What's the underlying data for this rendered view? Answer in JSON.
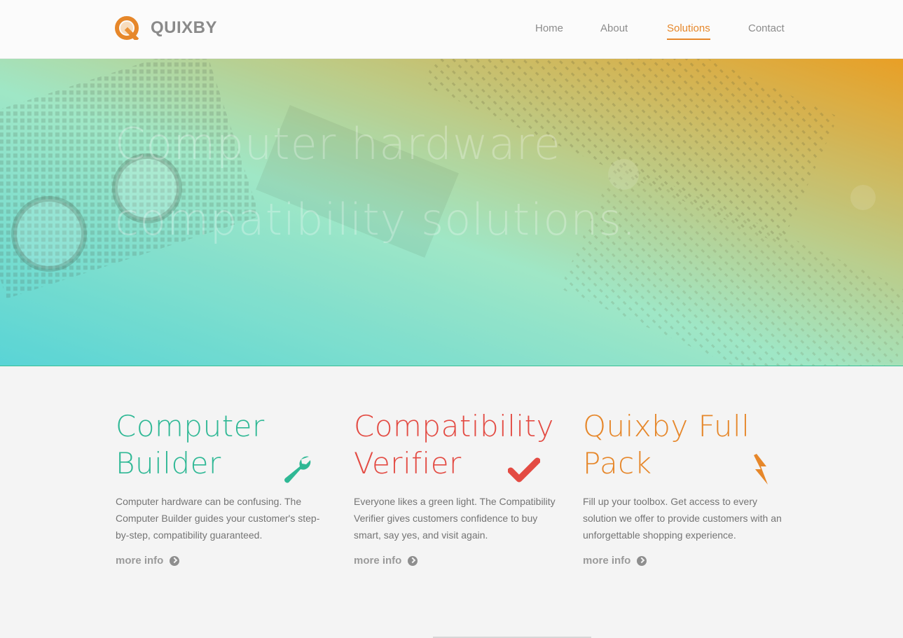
{
  "brand": {
    "name": "QUIXBY",
    "accent": "#e6872a"
  },
  "nav": {
    "items": [
      {
        "label": "Home"
      },
      {
        "label": "About"
      },
      {
        "label": "Solutions",
        "active": true
      },
      {
        "label": "Contact"
      }
    ]
  },
  "hero": {
    "title": "Computer hardware compatibility solutions.",
    "gradient": [
      "#4fd2d4",
      "#9ae6c3",
      "#e89a18"
    ]
  },
  "features": [
    {
      "title": "Computer Builder",
      "color": "#2fb895",
      "icon": "wrench-icon",
      "description": "Computer hardware can be confusing. The Computer Builder guides your customer's step-by-step, compatibility guaranteed.",
      "link": "more info"
    },
    {
      "title": "Compatibility Verifier",
      "color": "#e34b43",
      "icon": "checkmark-icon",
      "description": "Everyone likes a green light. The Compatibility Verifier gives customers confidence to buy smart, say yes, and visit again.",
      "link": "more info"
    },
    {
      "title": "Quixby Full Pack",
      "color": "#e6872a",
      "icon": "lightning-icon",
      "description": "Fill up your toolbox. Get access to every solution we offer to provide customers with an unforgettable shopping experience.",
      "link": "more info"
    }
  ]
}
